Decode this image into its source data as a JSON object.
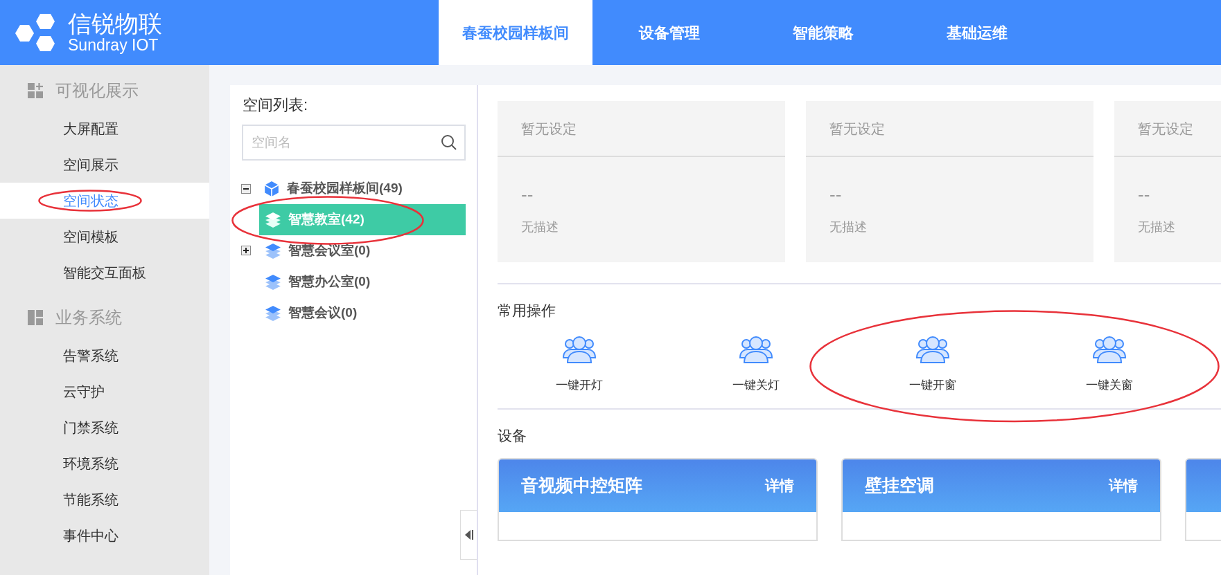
{
  "brand": {
    "name": "信锐物联",
    "subtitle": "Sundray IOT"
  },
  "tabs": [
    {
      "label": "春蚕校园样板间",
      "selected": true
    },
    {
      "label": "设备管理",
      "selected": false
    },
    {
      "label": "智能策略",
      "selected": false
    },
    {
      "label": "基础运维",
      "selected": false
    }
  ],
  "sidebar": {
    "groups": [
      {
        "title": "可视化展示",
        "items": [
          {
            "label": "大屏配置",
            "selected": false,
            "circled": false
          },
          {
            "label": "空间展示",
            "selected": false,
            "circled": false
          },
          {
            "label": "空间状态",
            "selected": true,
            "circled": true
          },
          {
            "label": "空间模板",
            "selected": false,
            "circled": false
          },
          {
            "label": "智能交互面板",
            "selected": false,
            "circled": false
          }
        ]
      },
      {
        "title": "业务系统",
        "items": [
          {
            "label": "告警系统",
            "selected": false,
            "circled": false
          },
          {
            "label": "云守护",
            "selected": false,
            "circled": false
          },
          {
            "label": "门禁系统",
            "selected": false,
            "circled": false
          },
          {
            "label": "环境系统",
            "selected": false,
            "circled": false
          },
          {
            "label": "节能系统",
            "selected": false,
            "circled": false
          },
          {
            "label": "事件中心",
            "selected": false,
            "circled": false
          }
        ]
      }
    ]
  },
  "space_list": {
    "title": "空间列表:",
    "search": {
      "placeholder": "空间名"
    },
    "tree": [
      {
        "label": "春蚕校园样板间(49)",
        "kind": "root",
        "expanded": true,
        "selected": false,
        "circled": false,
        "children": [
          {
            "label": "智慧教室(42)",
            "kind": "space",
            "selected": true,
            "circled": true
          },
          {
            "label": "智慧会议室(0)",
            "kind": "space",
            "expanded": false,
            "selected": false,
            "circled": false
          },
          {
            "label": "智慧办公室(0)",
            "kind": "space",
            "selected": false,
            "circled": false
          },
          {
            "label": "智慧会议(0)",
            "kind": "space",
            "selected": false,
            "circled": false
          }
        ]
      }
    ]
  },
  "metrics": [
    {
      "title": "暂无设定",
      "value": "--",
      "description": "无描述"
    },
    {
      "title": "暂无设定",
      "value": "--",
      "description": "无描述"
    },
    {
      "title": "暂无设定",
      "value": "--",
      "description": "无描述"
    }
  ],
  "actions": {
    "title": "常用操作",
    "items": [
      {
        "label": "一键开灯",
        "circled": false
      },
      {
        "label": "一键关灯",
        "circled": false
      },
      {
        "label": "一键开窗",
        "circled": true
      },
      {
        "label": "一键关窗",
        "circled": true
      }
    ]
  },
  "devices": {
    "title": "设备",
    "items": [
      {
        "kind": "card",
        "title": "音视频中控矩阵",
        "link": "详情"
      },
      {
        "kind": "card",
        "title": "壁挂空调",
        "link": "详情"
      },
      {
        "kind": "partial"
      }
    ]
  }
}
